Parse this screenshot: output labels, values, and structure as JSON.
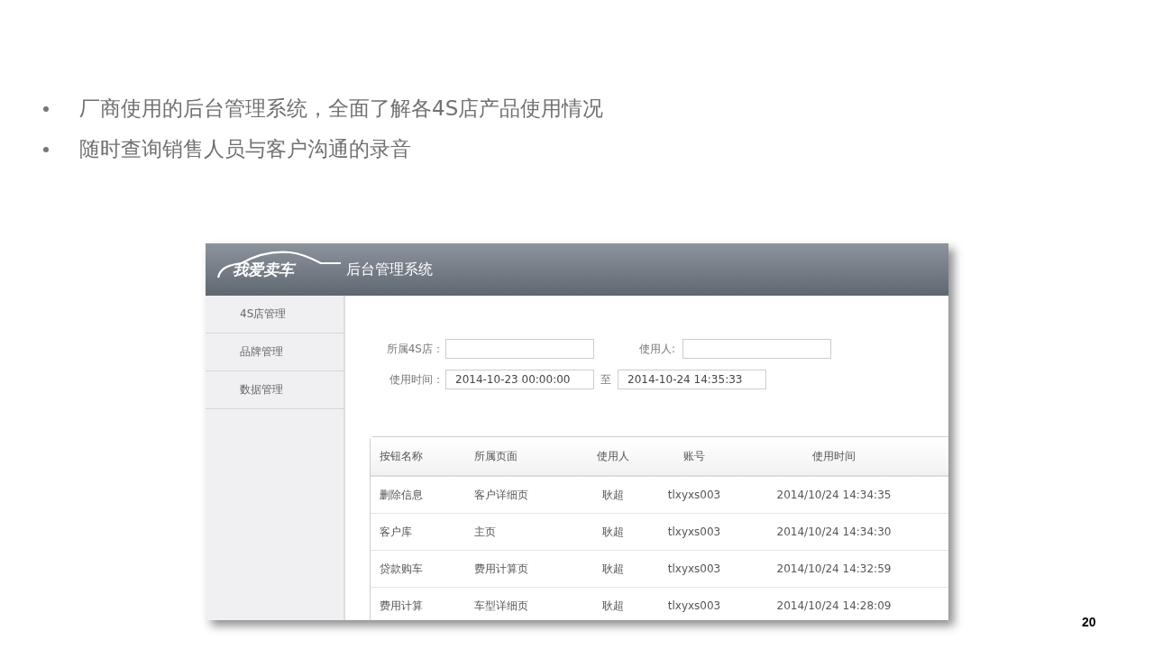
{
  "bullets": [
    "厂商使用的后台管理系统，全面了解各4S店产品使用情况",
    "随时查询销售人员与客户沟通的录音"
  ],
  "app": {
    "logo_text": "我爱卖车",
    "title": "后台管理系统",
    "sidebar": [
      {
        "label": "4S店管理"
      },
      {
        "label": "品牌管理"
      },
      {
        "label": "数据管理"
      }
    ],
    "filters": {
      "shop_label": "所属4S店：",
      "user_label": "使用人:",
      "time_label": "使用时间：",
      "time_from": "2014-10-23 00:00:00",
      "separator": "至",
      "time_to": "2014-10-24 14:35:33"
    },
    "table": {
      "columns": [
        "按钮名称",
        "所属页面",
        "使用人",
        "账号",
        "使用时间"
      ],
      "rows": [
        [
          "删除信息",
          "客户详细页",
          "耿超",
          "tlxyxs003",
          "2014/10/24 14:34:35"
        ],
        [
          "客户库",
          "主页",
          "耿超",
          "tlxyxs003",
          "2014/10/24 14:34:30"
        ],
        [
          "贷款购车",
          "费用计算页",
          "耿超",
          "tlxyxs003",
          "2014/10/24 14:32:59"
        ],
        [
          "费用计算",
          "车型详细页",
          "耿超",
          "tlxyxs003",
          "2014/10/24 14:28:09"
        ]
      ]
    }
  },
  "page_number": "20"
}
